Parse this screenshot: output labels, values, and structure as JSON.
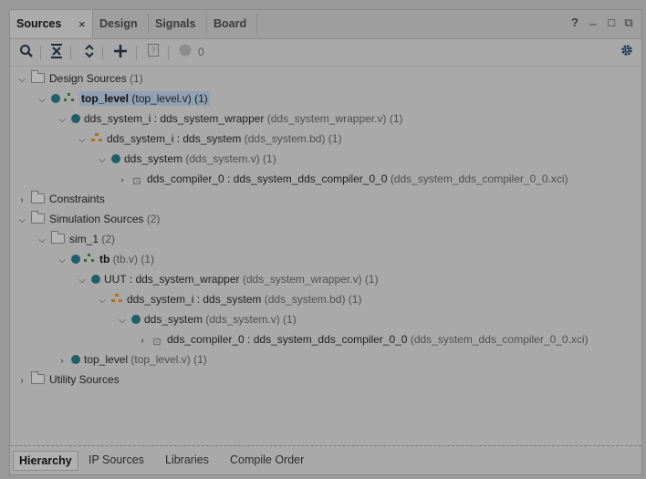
{
  "tabs": [
    {
      "label": "Sources",
      "active": true
    },
    {
      "label": "Design"
    },
    {
      "label": "Signals"
    },
    {
      "label": "Board"
    }
  ],
  "tab_close": "×",
  "window_buttons": {
    "help": "?",
    "minimize": "_",
    "maximize": "□",
    "float": "⧉"
  },
  "toolbar": {
    "icons": [
      "search-icon",
      "collapse-all-icon",
      "expand-all-icon",
      "add-sources-icon",
      "properties-icon",
      "status-dot-icon",
      "settings-gear-icon"
    ],
    "message_count": "0"
  },
  "tree": [
    {
      "name": "Design Sources",
      "detail": "(1)"
    },
    {
      "name": "top_level",
      "detail": "(top_level.v) (1)"
    },
    {
      "name": "dds_system_i : dds_system_wrapper",
      "detail": "(dds_system_wrapper.v) (1)"
    },
    {
      "name": "dds_system_i : dds_system",
      "detail": "(dds_system.bd) (1)"
    },
    {
      "name": "dds_system",
      "detail": "(dds_system.v) (1)"
    },
    {
      "name": "dds_compiler_0 : dds_system_dds_compiler_0_0",
      "detail": "(dds_system_dds_compiler_0_0.xci)"
    },
    {
      "name": "Constraints",
      "detail": ""
    },
    {
      "name": "Simulation Sources",
      "detail": "(2)"
    },
    {
      "name": "sim_1",
      "detail": "(2)"
    },
    {
      "name": "tb",
      "detail": "(tb.v) (1)"
    },
    {
      "name": "UUT : dds_system_wrapper",
      "detail": "(dds_system_wrapper.v) (1)"
    },
    {
      "name": "dds_system_i : dds_system",
      "detail": "(dds_system.bd) (1)"
    },
    {
      "name": "dds_system",
      "detail": "(dds_system.v) (1)"
    },
    {
      "name": "dds_compiler_0 : dds_system_dds_compiler_0_0",
      "detail": "(dds_system_dds_compiler_0_0.xci)"
    },
    {
      "name": "top_level",
      "detail": "(top_level.v) (1)"
    },
    {
      "name": "Utility Sources",
      "detail": ""
    }
  ],
  "bottom_tabs": [
    {
      "label": "Hierarchy",
      "active": true
    },
    {
      "label": "IP Sources"
    },
    {
      "label": "Libraries"
    },
    {
      "label": "Compile Order"
    }
  ],
  "colors": {
    "module_dot": "#1f5f6b",
    "selection": "#8fa1b3",
    "block_design": "#b56f16"
  }
}
